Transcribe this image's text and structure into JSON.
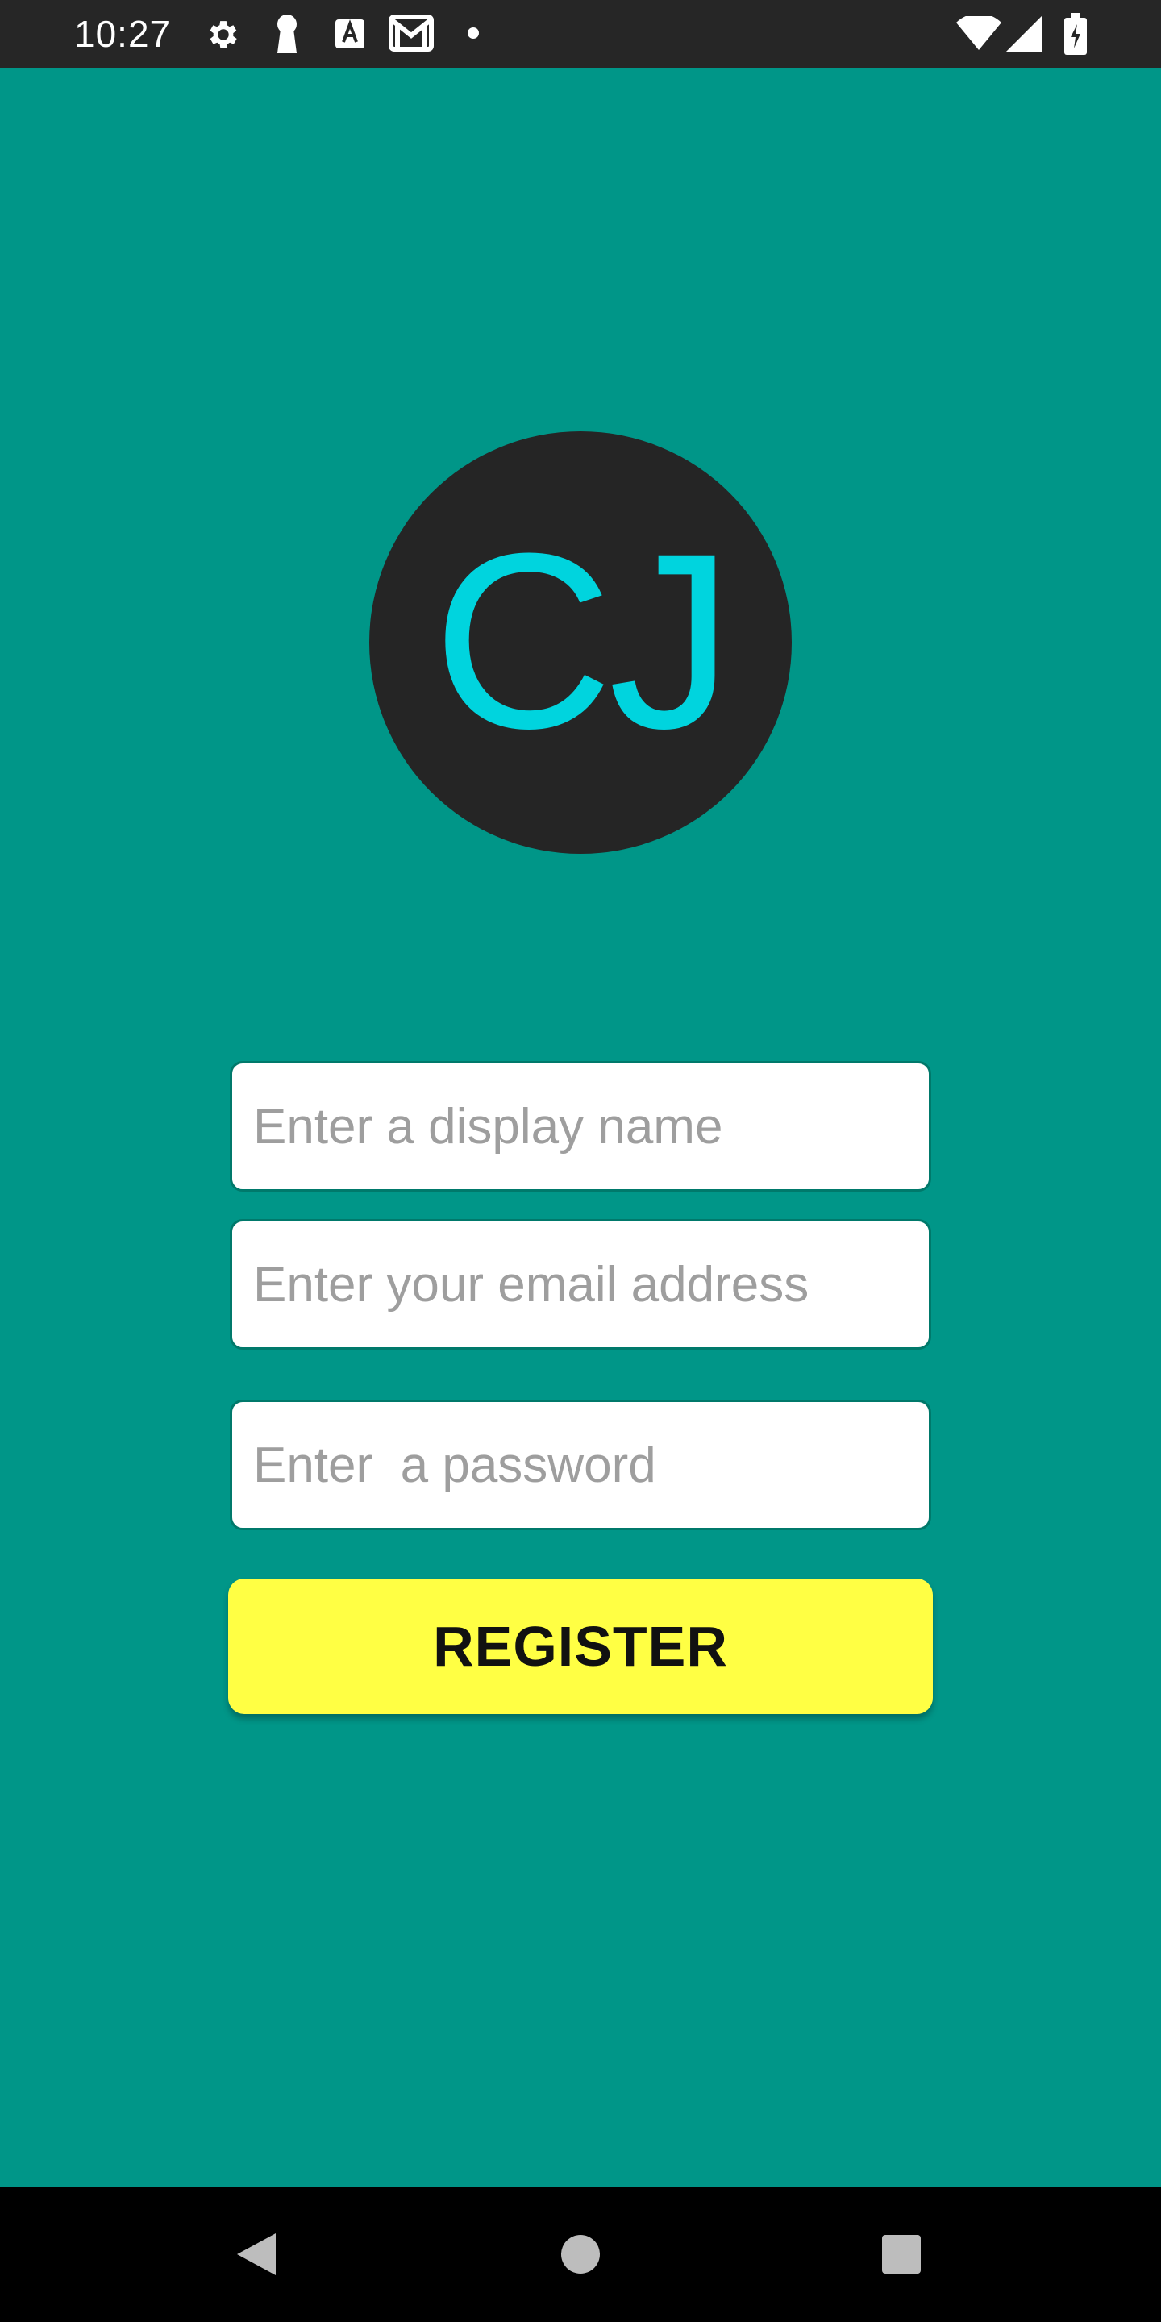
{
  "status_bar": {
    "time": "10:27",
    "left_icons": [
      "gear-icon",
      "keyhole-icon",
      "a-icon",
      "mail-icon",
      "dot-icon"
    ],
    "right_icons": [
      "wifi-icon",
      "signal-icon",
      "battery-icon"
    ]
  },
  "logo": {
    "text": "CJ",
    "text_color": "#00D4DE",
    "background": "#252525"
  },
  "form": {
    "display_name": {
      "value": "",
      "placeholder": "Enter a display name"
    },
    "email": {
      "value": "",
      "placeholder": "Enter your email address"
    },
    "password": {
      "value": "",
      "placeholder": "Enter  a password"
    },
    "register_label": "REGISTER"
  },
  "nav_bar": {
    "buttons": [
      "back-icon",
      "home-icon",
      "recents-icon"
    ]
  },
  "colors": {
    "background": "#009688",
    "status_bar": "#262626",
    "button": "#FFFF44",
    "nav_bar": "#000000"
  }
}
